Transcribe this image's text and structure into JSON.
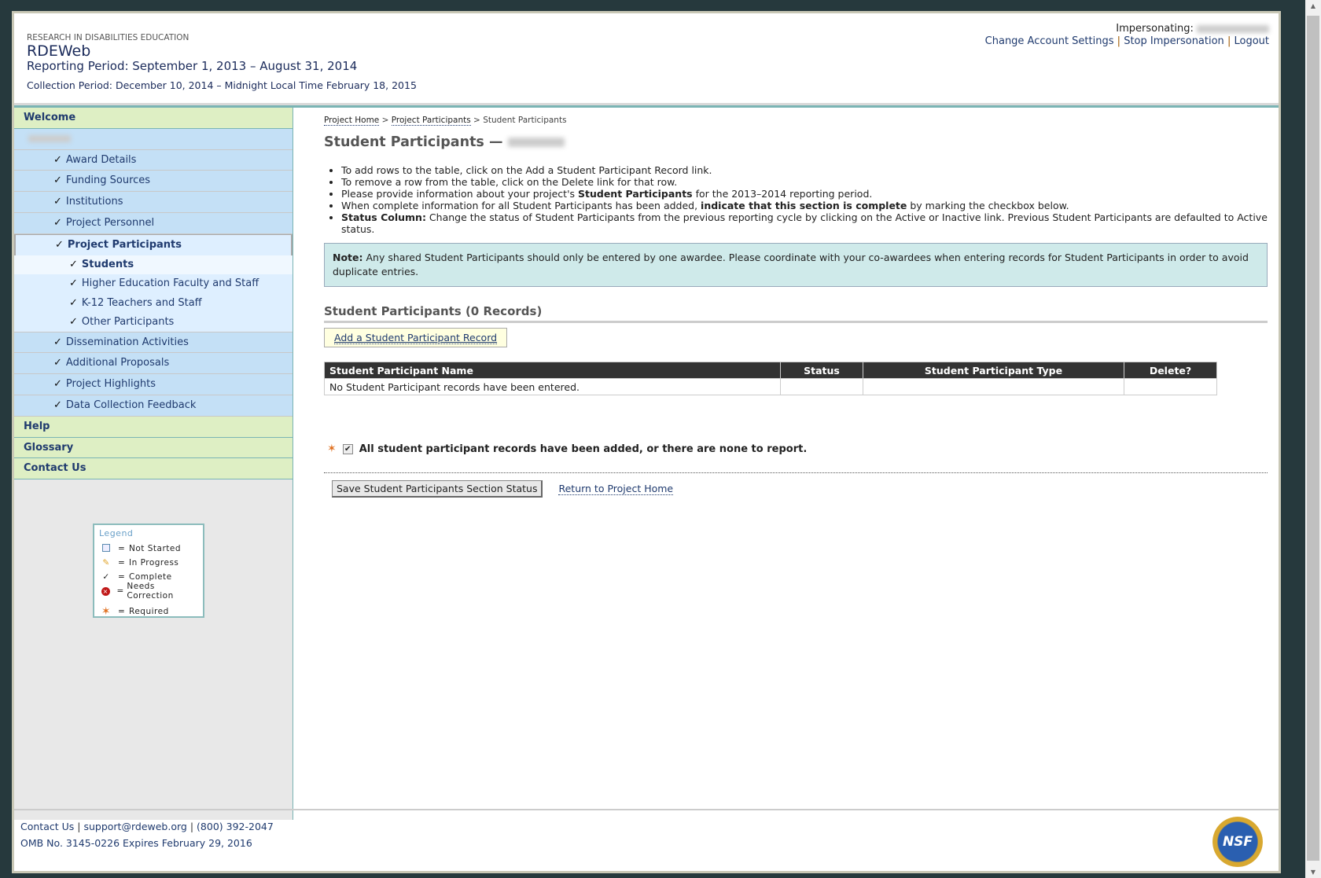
{
  "header": {
    "org": "RESEARCH IN DISABILITIES EDUCATION",
    "app": "RDEWeb",
    "reporting_period": "Reporting Period: September 1, 2013 – August 31, 2014",
    "collection_period": "Collection Period: December 10, 2014 – Midnight Local Time February 18, 2015",
    "impersonating_label": "Impersonating:",
    "links": [
      "Change Account Settings",
      "Stop Impersonation",
      "Logout"
    ]
  },
  "sidebar": {
    "welcome": "Welcome",
    "items": [
      "Award Details",
      "Funding Sources",
      "Institutions",
      "Project Personnel",
      "Project Participants"
    ],
    "subitems": [
      "Students",
      "Higher Education Faculty and Staff",
      "K-12 Teachers and Staff",
      "Other Participants"
    ],
    "items2": [
      "Dissemination Activities",
      "Additional Proposals",
      "Project Highlights",
      "Data Collection Feedback"
    ],
    "bottom": [
      "Help",
      "Glossary",
      "Contact Us"
    ],
    "check": "✓"
  },
  "legend": {
    "title": "Legend",
    "rows": [
      {
        "icon": "empty-box-icon",
        "label": "Not Started"
      },
      {
        "icon": "pencil-icon",
        "label": "In Progress"
      },
      {
        "icon": "check-icon",
        "label": "Complete"
      },
      {
        "icon": "error-icon",
        "label": "Needs Correction"
      },
      {
        "icon": "asterisk-icon",
        "label": "Required"
      }
    ]
  },
  "main": {
    "breadcrumb": [
      "Project Home",
      "Project Participants",
      "Student Participants"
    ],
    "title": "Student Participants —",
    "bullets": {
      "b1": "To add rows to the table, click on the Add a Student Participant Record link.",
      "b2": "To remove a row from the table, click on the Delete link for that row.",
      "b3a": "Please provide information about your project's ",
      "b3b": "Student Participants",
      "b3c": " for the 2013–2014 reporting period.",
      "b4a": "When complete information for all Student Participants has been added, ",
      "b4b": "indicate that this section is complete",
      "b4c": " by marking the checkbox below.",
      "b5a": "Status Column:",
      "b5b": " Change the status of Student Participants from the previous reporting cycle by clicking on the Active or Inactive link. Previous Student Participants are defaulted to Active status."
    },
    "note_label": "Note:",
    "note": " Any shared Student Participants should only be entered by one awardee. Please coordinate with your co-awardees when entering records for Student Participants in order to avoid duplicate entries.",
    "section_title": "Student Participants (0 Records)",
    "add_button": "Add a Student Participant Record",
    "table": {
      "columns": [
        "Student Participant Name",
        "Status",
        "Student Participant Type",
        "Delete?"
      ],
      "empty": "No Student Participant records have been entered."
    },
    "confirm": "All student participant records have been added, or there are none to report.",
    "confirm_checked": true,
    "save_button": "Save Student Participants Section Status",
    "return_link": "Return to Project Home"
  },
  "footer": {
    "contact": "Contact Us",
    "email": "support@rdeweb.org",
    "phone": "(800) 392-2047",
    "omb": "OMB No. 3145-0226 Expires February 29, 2016",
    "logo": "NSF"
  }
}
